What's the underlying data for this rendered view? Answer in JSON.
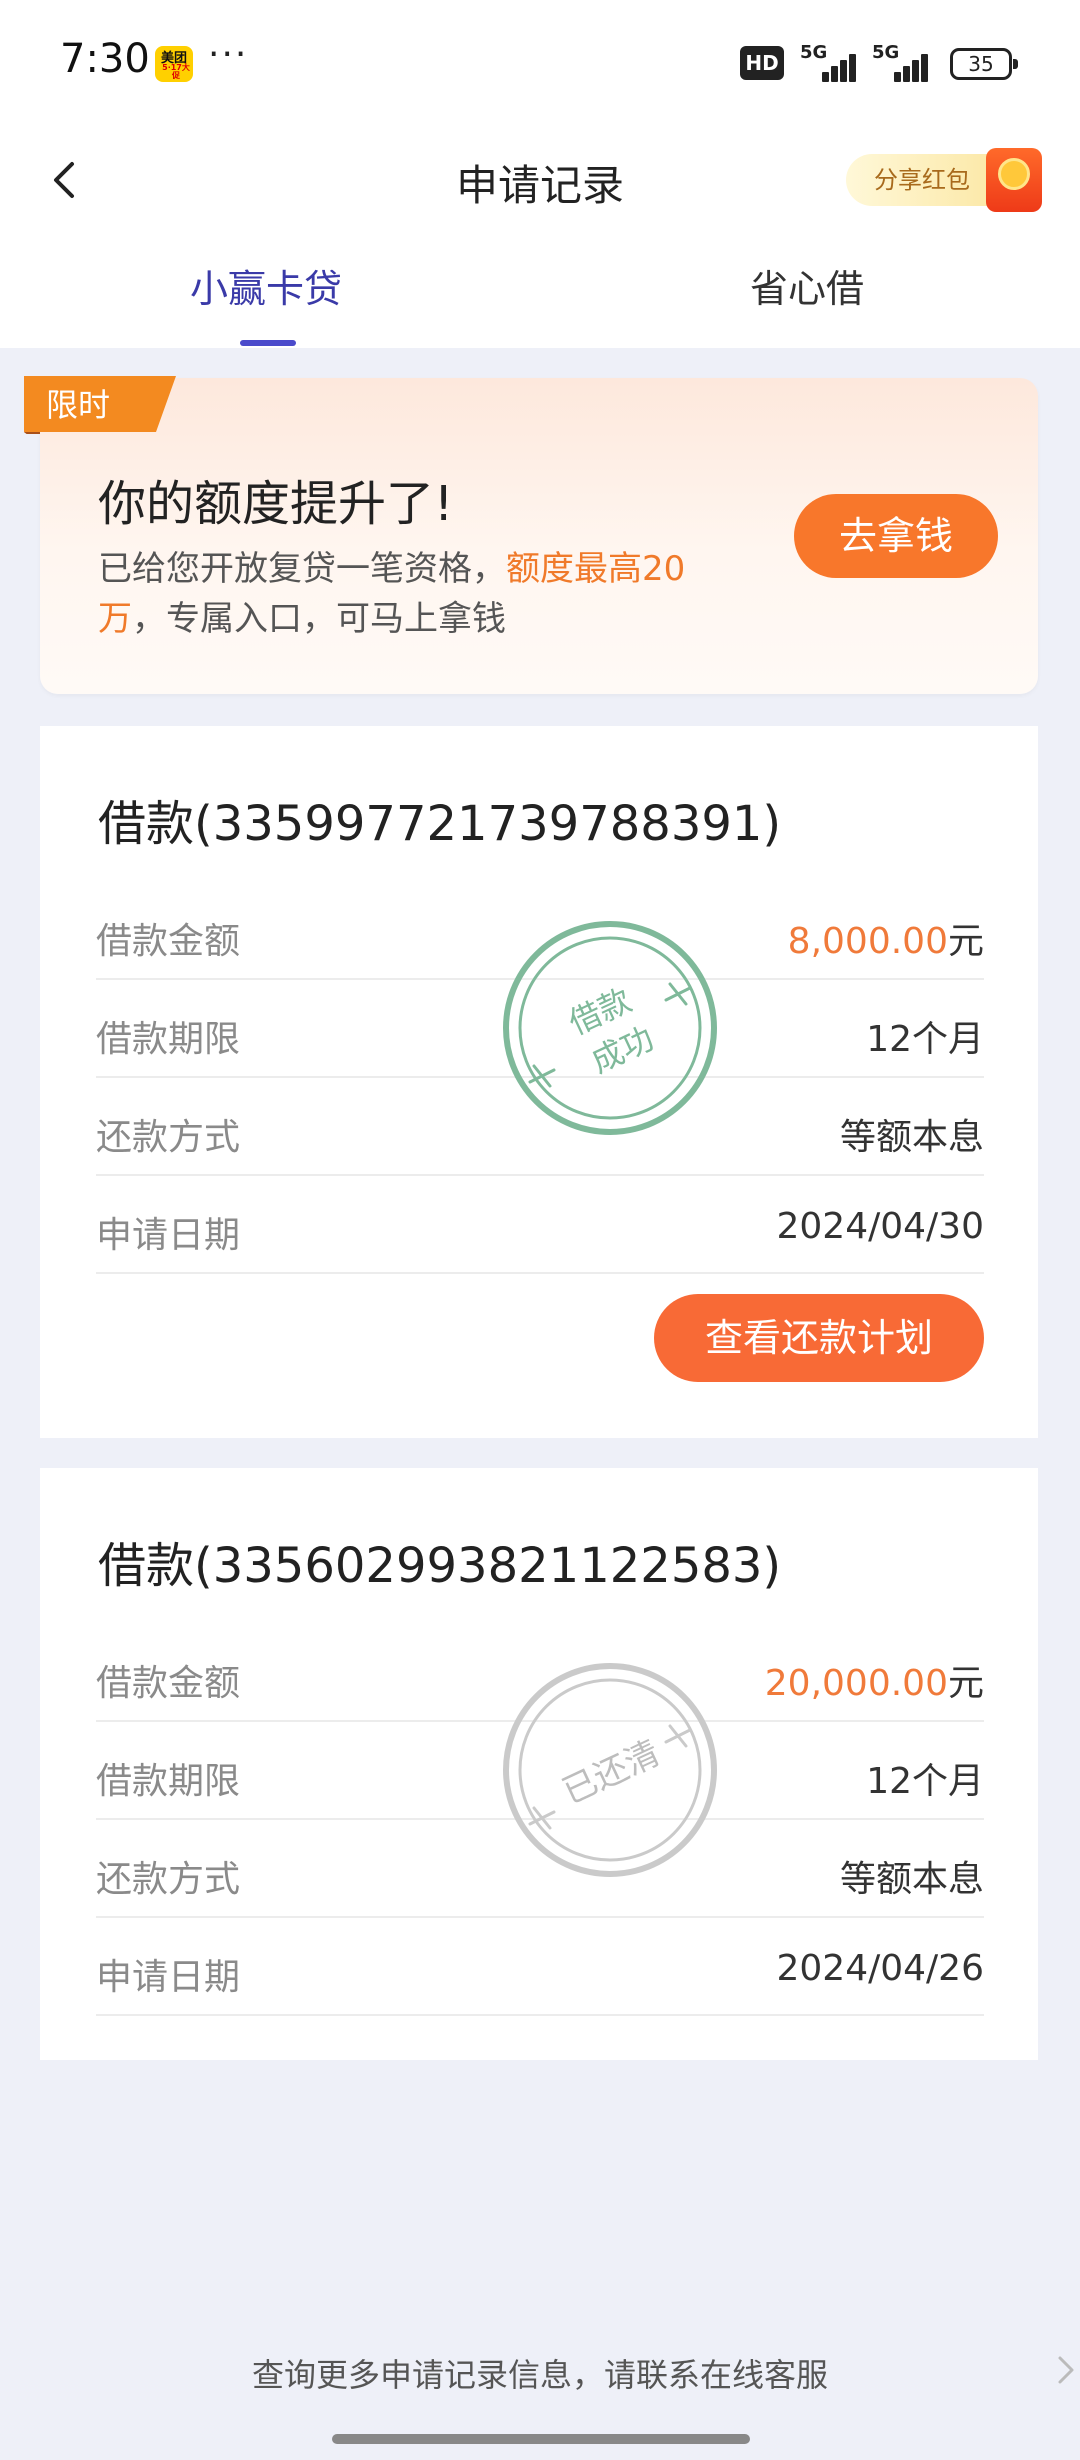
{
  "status_bar": {
    "time": "7:30",
    "app_badge_label": "美团",
    "app_badge_sub": "5·17大促",
    "more": "···",
    "hd": "HD",
    "net1": "5G",
    "net2": "5G",
    "battery": "35"
  },
  "nav": {
    "title": "申请记录",
    "share_label": "分享红包"
  },
  "tabs": [
    {
      "label": "小赢卡贷",
      "active": true
    },
    {
      "label": "省心借",
      "active": false
    }
  ],
  "promo": {
    "tag": "限时",
    "title": "你的额度提升了!",
    "desc_pre": "已给您开放复贷一笔资格，",
    "desc_hl1": "额度最高20",
    "desc_hl2": "万",
    "desc_post": "，专属入口，可马上拿钱",
    "button": "去拿钱"
  },
  "loans": [
    {
      "title": "借款(335997721739788391)",
      "stamp_line1": "借款",
      "stamp_line2": "成功",
      "rows": [
        {
          "label": "借款金额",
          "amount": "8,000.00",
          "unit": "元"
        },
        {
          "label": "借款期限",
          "value": "12个月"
        },
        {
          "label": "还款方式",
          "value": "等额本息"
        },
        {
          "label": "申请日期",
          "value": "2024/04/30"
        }
      ],
      "button": "查看还款计划"
    },
    {
      "title": "借款(335602993821122583)",
      "stamp_line1": "已还清",
      "rows": [
        {
          "label": "借款金额",
          "amount": "20,000.00",
          "unit": "元"
        },
        {
          "label": "借款期限",
          "value": "12个月"
        },
        {
          "label": "还款方式",
          "value": "等额本息"
        },
        {
          "label": "申请日期",
          "value": "2024/04/26"
        }
      ]
    }
  ],
  "footer": "查询更多申请记录信息，请联系在线客服",
  "colors": {
    "accent_tab": "#3a3aa8",
    "orange": "#f8772b",
    "stamp_green": "#7fb99a",
    "stamp_grey": "#c8c8c8"
  }
}
